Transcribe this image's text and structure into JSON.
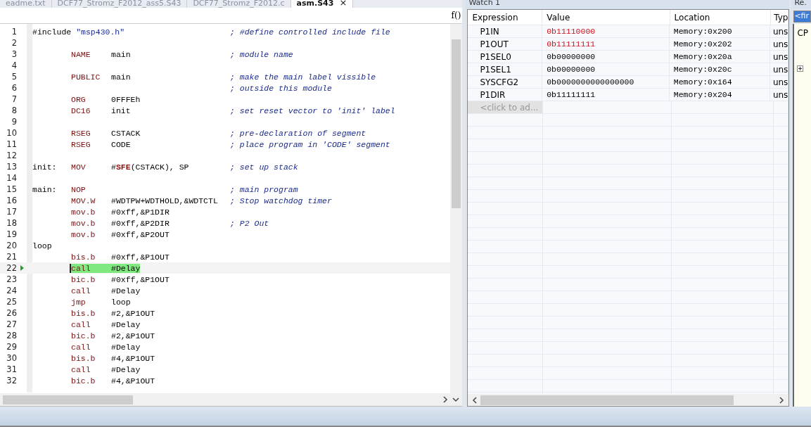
{
  "tabs": [
    {
      "label": "eadme.txt",
      "selected": false
    },
    {
      "label": "DCF77_Stromz_F2012_ass5.S43",
      "selected": false
    },
    {
      "label": "DCF77_Stromz_F2012.c",
      "selected": false
    },
    {
      "label": "asm.S43",
      "selected": true,
      "close": "×"
    }
  ],
  "editor": {
    "function_button": "f()",
    "lines": [
      {
        "num": "1",
        "include": {
          "directive": "#include",
          "file": "\"msp430.h\""
        },
        "comment": "; #define controlled include file"
      },
      {
        "num": "2"
      },
      {
        "num": "3",
        "op": "NAME",
        "args": "main",
        "comment": "; module name"
      },
      {
        "num": "4"
      },
      {
        "num": "5",
        "op": "PUBLIC",
        "args": "main",
        "comment": "; make the main label vissible"
      },
      {
        "num": "6",
        "comment": "; outside this module"
      },
      {
        "num": "7",
        "op": "ORG",
        "args": "0FFFEh"
      },
      {
        "num": "8",
        "op": "DC16",
        "args": "init",
        "comment": "; set reset vector to 'init' label"
      },
      {
        "num": "9"
      },
      {
        "num": "10",
        "op": "RSEG",
        "args": "CSTACK",
        "comment": "; pre-declaration of segment"
      },
      {
        "num": "11",
        "op": "RSEG",
        "args": "CODE",
        "comment": "; place program in 'CODE' segment"
      },
      {
        "num": "12"
      },
      {
        "num": "13",
        "label": "init:",
        "op": "MOV",
        "args": "#**SFE**(CSTACK), SP",
        "comment": "; set up stack"
      },
      {
        "num": "14"
      },
      {
        "num": "15",
        "label": "main:",
        "op": "NOP",
        "comment": "; main program"
      },
      {
        "num": "16",
        "op": "MOV.W",
        "args": "#WDTPW+WDTHOLD,&WDTCTL",
        "comment": "; Stop watchdog timer"
      },
      {
        "num": "17",
        "op": "mov.b",
        "args": "#0xff,&P1DIR"
      },
      {
        "num": "18",
        "op": "mov.b",
        "args": "#0xff,&P2DIR",
        "comment": "; P2 Out"
      },
      {
        "num": "19",
        "op": "mov.b",
        "args": "#0xff,&P2OUT"
      },
      {
        "num": "20",
        "label": "loop"
      },
      {
        "num": "21",
        "op": "bis.b",
        "args": "#0xff,&P1OUT"
      },
      {
        "num": "22",
        "op": "call",
        "args": "#Delay",
        "current": true
      },
      {
        "num": "23",
        "op": "bic.b",
        "args": "#0xff,&P1OUT"
      },
      {
        "num": "24",
        "op": "call",
        "args": "#Delay"
      },
      {
        "num": "25",
        "op": "jmp",
        "args": "loop"
      },
      {
        "num": "26",
        "op": "bis.b",
        "args": "#2,&P1OUT"
      },
      {
        "num": "27",
        "op": "call",
        "args": "#Delay"
      },
      {
        "num": "28",
        "op": "bic.b",
        "args": "#2,&P1OUT"
      },
      {
        "num": "29",
        "op": "call",
        "args": "#Delay"
      },
      {
        "num": "30",
        "op": "bis.b",
        "args": "#4,&P1OUT"
      },
      {
        "num": "31",
        "op": "call",
        "args": "#Delay"
      },
      {
        "num": "32",
        "op": "bic.b",
        "args": "#4,&P1OUT"
      }
    ]
  },
  "watch": {
    "title": "Watch 1",
    "columns": [
      "Expression",
      "Value",
      "Location",
      "Typ"
    ],
    "rows": [
      {
        "expression": "P1IN",
        "value": "0b11110000",
        "location": "Memory:0x200",
        "type": "uns",
        "changed": true
      },
      {
        "expression": "P1OUT",
        "value": "0b11111111",
        "location": "Memory:0x202",
        "type": "uns",
        "changed": true
      },
      {
        "expression": "P1SEL0",
        "value": "0b00000000",
        "location": "Memory:0x20a",
        "type": "uns",
        "changed": false
      },
      {
        "expression": "P1SEL1",
        "value": "0b00000000",
        "location": "Memory:0x20c",
        "type": "uns",
        "changed": false
      },
      {
        "expression": "SYSCFG2",
        "value": "0b0000000000000000",
        "location": "Memory:0x164",
        "type": "uns",
        "changed": false
      },
      {
        "expression": "P1DIR",
        "value": "0b11111111",
        "location": "Memory:0x204",
        "type": "uns",
        "changed": false
      }
    ],
    "add_placeholder": "<click to ad..."
  },
  "side_panel": {
    "title": "Re.",
    "field": "<fir",
    "item": "CP"
  }
}
